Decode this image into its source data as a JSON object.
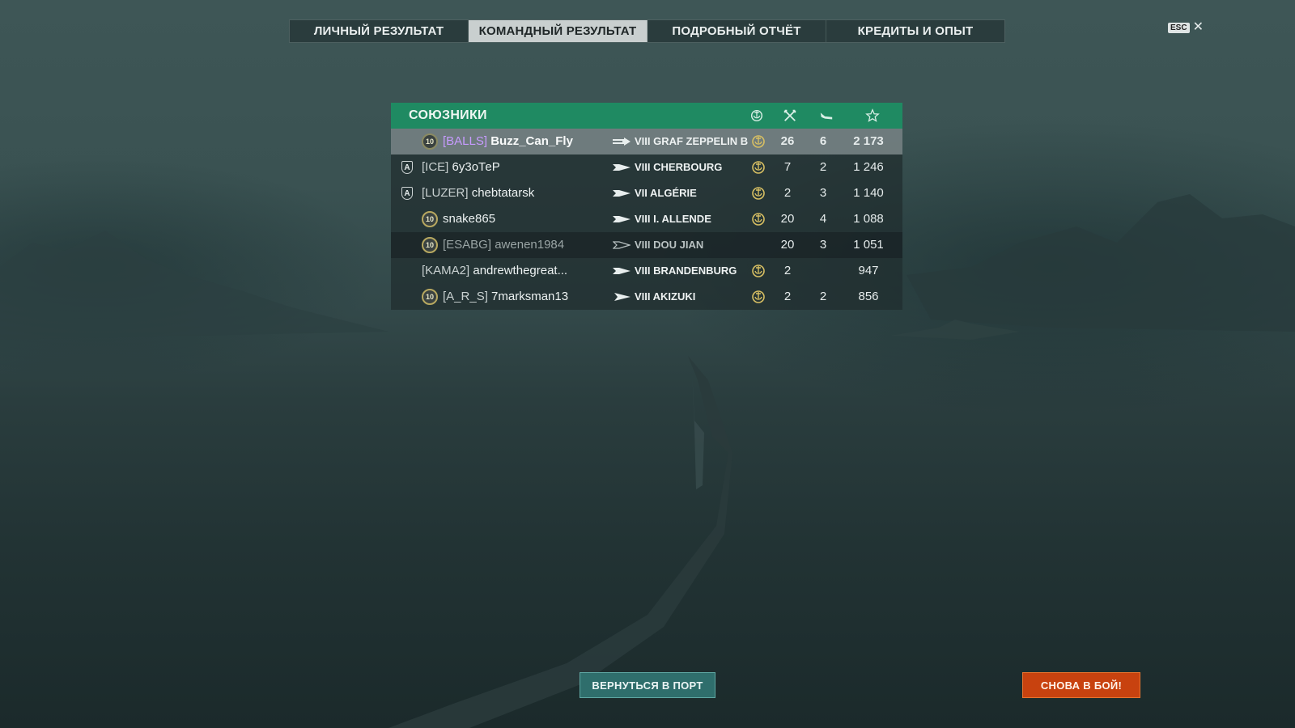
{
  "tabs": [
    {
      "label": "ЛИЧНЫЙ РЕЗУЛЬТАТ"
    },
    {
      "label": "КОМАНДНЫЙ РЕЗУЛЬТАТ"
    },
    {
      "label": "ПОДРОБНЫЙ ОТЧЁТ"
    },
    {
      "label": "КРЕДИТЫ И ОПЫТ"
    }
  ],
  "active_tab": "КОМАНДНЫЙ РЕЗУЛЬТАТ",
  "close": {
    "key_label": "ESC",
    "close_glyph": "✕"
  },
  "team": {
    "title": "СОЮЗНИКИ",
    "columns": [
      "base-capture-icon",
      "kills-icon",
      "planes-icon",
      "experience-star-icon"
    ],
    "rows": [
      {
        "rank": "",
        "level": "10",
        "clan": "[BALLS]",
        "name": "Buzz_Can_Fly",
        "ship_class": "aircraft-carrier",
        "ship": "VIII GRAF ZEPPELIN B",
        "badge": true,
        "c1": "26",
        "c2": "6",
        "c3": "2 173"
      },
      {
        "rank": "A",
        "level": "",
        "clan": "[ICE]",
        "name": "6у3оТеР",
        "ship_class": "cruiser",
        "ship": "VIII CHERBOURG",
        "badge": true,
        "c1": "7",
        "c2": "2",
        "c3": "1 246"
      },
      {
        "rank": "A",
        "level": "",
        "clan": "[LUZER]",
        "name": "chebtatarsk",
        "ship_class": "cruiser",
        "ship": "VII ALGÉRIE",
        "badge": true,
        "c1": "2",
        "c2": "3",
        "c3": "1 140"
      },
      {
        "rank": "",
        "level": "10",
        "clan": "",
        "name": "snake865",
        "ship_class": "cruiser",
        "ship": "VIII I. ALLENDE",
        "badge": true,
        "c1": "20",
        "c2": "4",
        "c3": "1 088"
      },
      {
        "rank": "",
        "level": "10",
        "clan": "[ESABG]",
        "name": "awenen1984",
        "ship_class": "cruiser",
        "ship": "VIII DOU JIAN",
        "badge": false,
        "c1": "20",
        "c2": "3",
        "c3": "1 051"
      },
      {
        "rank": "",
        "level": "",
        "clan": "[KAMA2]",
        "name": "andrewthegreat...",
        "ship_class": "cruiser",
        "ship": "VIII BRANDENBURG",
        "badge": true,
        "c1": "2",
        "c2": "",
        "c3": "947"
      },
      {
        "rank": "",
        "level": "10",
        "clan": "[A_R_S]",
        "name": "7marksman13",
        "ship_class": "destroyer",
        "ship": "VIII AKIZUKI",
        "badge": true,
        "c1": "2",
        "c2": "2",
        "c3": "856"
      }
    ]
  },
  "buttons": {
    "return_port": "ВЕРНУТЬСЯ В ПОРТ",
    "battle_again": "СНОВА В БОЙ!"
  },
  "colors": {
    "header_green": "#1f8a62",
    "battle_button": "#c8420f",
    "port_button": "#2f6e6c",
    "clan_highlight": "#c79bff"
  }
}
